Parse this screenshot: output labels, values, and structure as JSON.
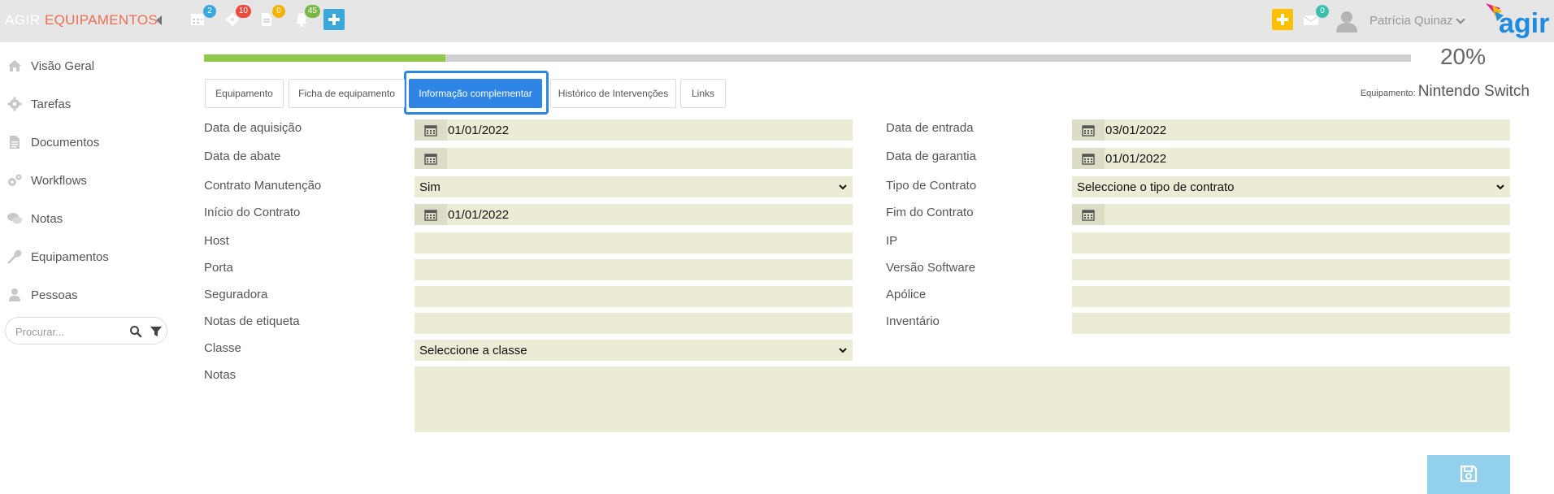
{
  "header": {
    "brand": "AGIR",
    "module": "EQUIPAMENTOS",
    "badges": {
      "calendar": "2",
      "settings": "10",
      "documents": "0",
      "notifications": "45",
      "messages": "0"
    },
    "user": "Patrícia Quinaz",
    "logo_text": "agir",
    "colors": {
      "accent": "#2e85e6",
      "brand_module": "#ee6e52",
      "plus": "#ffc000"
    }
  },
  "sidebar": {
    "items": [
      {
        "label": "Visão Geral",
        "icon": "home-icon"
      },
      {
        "label": "Tarefas",
        "icon": "gear-icon"
      },
      {
        "label": "Documentos",
        "icon": "document-icon"
      },
      {
        "label": "Workflows",
        "icon": "gears-icon"
      },
      {
        "label": "Notas",
        "icon": "comments-icon"
      },
      {
        "label": "Equipamentos",
        "icon": "wrench-icon"
      },
      {
        "label": "Pessoas",
        "icon": "person-icon"
      }
    ],
    "search_placeholder": "Procurar..."
  },
  "progress": {
    "value": 0.2,
    "label": "20%"
  },
  "tabs": [
    {
      "label": "Equipamento"
    },
    {
      "label": "Ficha de equipamento"
    },
    {
      "label": "Informação complementar",
      "active": true
    },
    {
      "label": "Histórico de Intervenções"
    },
    {
      "label": "Links"
    }
  ],
  "equipment": {
    "label": "Equipamento:",
    "name": "Nintendo Switch"
  },
  "form": {
    "data_aquisicao": {
      "label": "Data de aquisição",
      "value": "01/01/2022"
    },
    "data_abate": {
      "label": "Data de abate",
      "value": ""
    },
    "contrato_manutencao": {
      "label": "Contrato Manutenção",
      "value": "Sim"
    },
    "inicio_contrato": {
      "label": "Início do Contrato",
      "value": "01/01/2022"
    },
    "host": {
      "label": "Host",
      "value": ""
    },
    "porta": {
      "label": "Porta",
      "value": ""
    },
    "seguradora": {
      "label": "Seguradora",
      "value": ""
    },
    "notas_etiqueta": {
      "label": "Notas de etiqueta",
      "value": ""
    },
    "classe": {
      "label": "Classe",
      "value": "Seleccione a classe"
    },
    "notas": {
      "label": "Notas",
      "value": ""
    },
    "data_entrada": {
      "label": "Data de entrada",
      "value": "03/01/2022"
    },
    "data_garantia": {
      "label": "Data de garantia",
      "value": "01/01/2022"
    },
    "tipo_contrato": {
      "label": "Tipo de Contrato",
      "value": "Seleccione o tipo de contrato"
    },
    "fim_contrato": {
      "label": "Fim do Contrato",
      "value": ""
    },
    "ip": {
      "label": "IP",
      "value": ""
    },
    "versao_software": {
      "label": "Versão Software",
      "value": ""
    },
    "apolice": {
      "label": "Apólice",
      "value": ""
    },
    "inventario": {
      "label": "Inventário",
      "value": ""
    }
  },
  "actions": {
    "save_icon": "save-icon"
  }
}
